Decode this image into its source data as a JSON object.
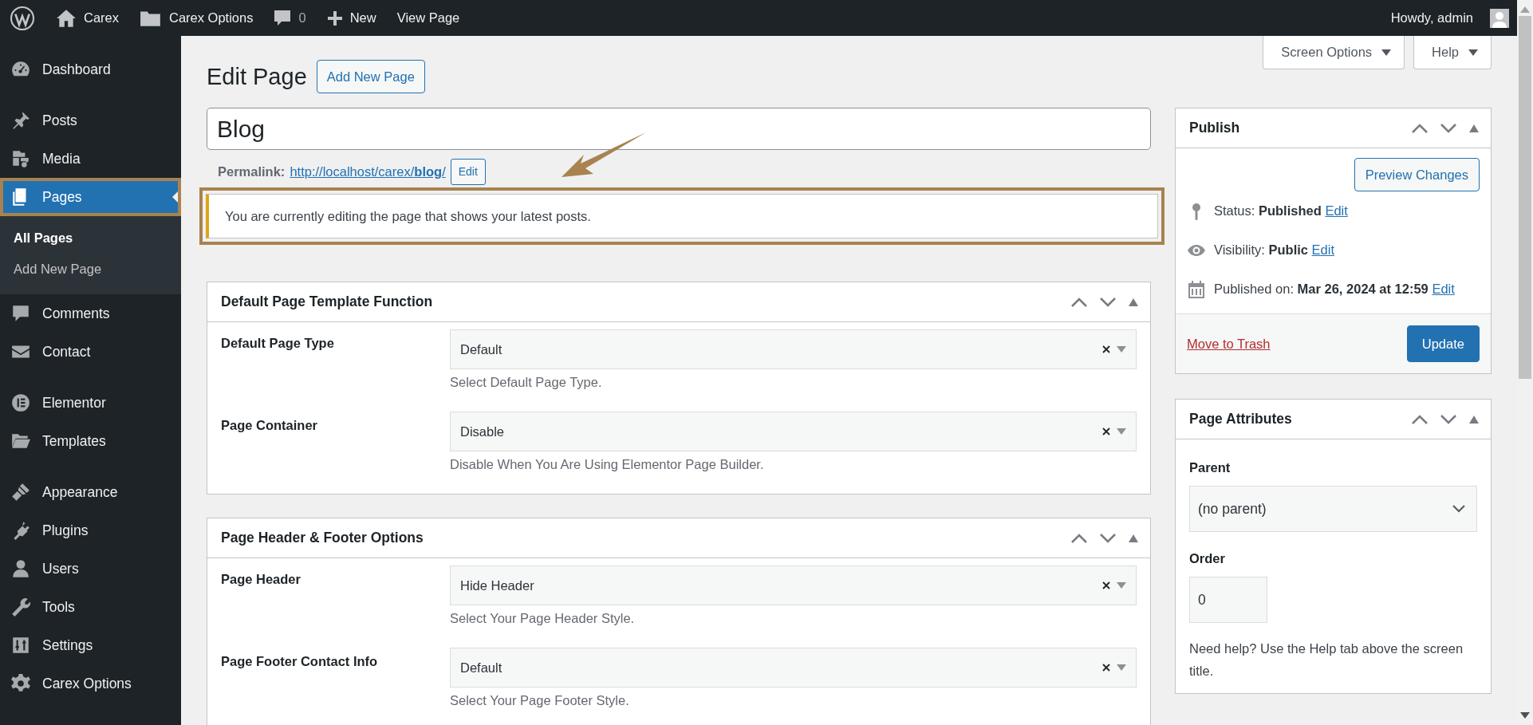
{
  "admin_bar": {
    "site": "Carex",
    "options": "Carex Options",
    "comments": "0",
    "new": "New",
    "view": "View Page",
    "greeting": "Howdy, admin"
  },
  "sidebar": {
    "groups": [
      {
        "items": [
          {
            "label": "Dashboard",
            "selected": false,
            "annotated": false
          }
        ]
      },
      {
        "items": [
          {
            "label": "Posts",
            "selected": false,
            "annotated": false
          },
          {
            "label": "Media",
            "selected": false,
            "annotated": false
          },
          {
            "label": "Pages",
            "selected": true,
            "annotated": true,
            "children": [
              {
                "label": "All Pages",
                "selected": true
              },
              {
                "label": "Add New Page",
                "selected": false
              }
            ]
          },
          {
            "label": "Comments",
            "selected": false,
            "annotated": false
          },
          {
            "label": "Contact",
            "selected": false,
            "annotated": false
          }
        ]
      },
      {
        "items": [
          {
            "label": "Elementor",
            "selected": false,
            "annotated": false
          },
          {
            "label": "Templates",
            "selected": false,
            "annotated": false
          }
        ]
      },
      {
        "items": [
          {
            "label": "Appearance",
            "selected": false,
            "annotated": false
          },
          {
            "label": "Plugins",
            "selected": false,
            "annotated": false
          },
          {
            "label": "Users",
            "selected": false,
            "annotated": false
          },
          {
            "label": "Tools",
            "selected": false,
            "annotated": false
          },
          {
            "label": "Settings",
            "selected": false,
            "annotated": false
          },
          {
            "label": "Carex Options",
            "selected": false,
            "annotated": false
          }
        ]
      }
    ]
  },
  "screen_meta": {
    "screen_options": "Screen Options",
    "help": "Help"
  },
  "header": {
    "title": "Edit Page",
    "add_new": "Add New Page"
  },
  "post_title": {
    "value": "Blog"
  },
  "permalink": {
    "label": "Permalink:",
    "url": "http://localhost/carex/**blog**/",
    "edit": "Edit"
  },
  "notice": {
    "text": "You are currently editing the page that shows your latest posts.",
    "annotated": true
  },
  "metaboxes": [
    {
      "title": "Default Page Template Function",
      "fields": [
        {
          "label": "Default Page Type",
          "value": "Default",
          "hint": "Select Default Page Type."
        },
        {
          "label": "Page Container",
          "value": "Disable",
          "hint": "Disable When You Are Using Elementor Page Builder."
        }
      ]
    },
    {
      "title": "Page Header & Footer Options",
      "fields": [
        {
          "label": "Page Header",
          "value": "Hide Header",
          "hint": "Select Your Page Header Style."
        },
        {
          "label": "Page Footer Contact Info",
          "value": "Default",
          "hint": "Select Your Page Footer Style."
        }
      ]
    }
  ],
  "publish": {
    "title": "Publish",
    "preview": "Preview Changes",
    "rows": [
      {
        "text": "Status: **Published**",
        "link": "Edit"
      },
      {
        "text": "Visibility: **Public**",
        "link": "Edit"
      },
      {
        "text": "Published on: **Mar 26, 2024 at 12:59**",
        "link": "Edit"
      }
    ],
    "trash": "Move to Trash",
    "update": "Update"
  },
  "page_attributes": {
    "title": "Page Attributes",
    "parent_label": "Parent",
    "parent_value": "(no parent)",
    "order_label": "Order",
    "order_value": "0",
    "help": "Need help? Use the Help tab above the screen title."
  }
}
